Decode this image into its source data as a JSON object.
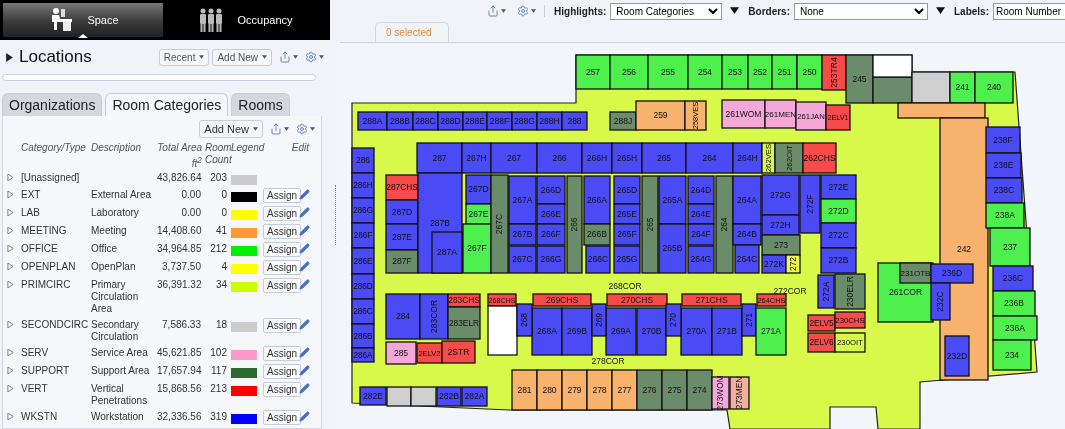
{
  "app_tabs": [
    {
      "label": "Space",
      "selected": true
    },
    {
      "label": "Occupancy",
      "selected": false
    }
  ],
  "locations": {
    "title": "Locations",
    "buttons": [
      "Recent",
      "Add New"
    ]
  },
  "tabs": [
    {
      "label": "Organizations",
      "selected": false
    },
    {
      "label": "Room Categories",
      "selected": true
    },
    {
      "label": "Rooms",
      "selected": false
    }
  ],
  "categories": {
    "add_button": "Add New",
    "columns": [
      "Category/Type",
      "Description",
      "Total Area ft$^{2}$",
      "Room Count",
      "Legend",
      "Edit"
    ],
    "rows": [
      {
        "code": "[Unassigned]",
        "area": "43,826.64",
        "count": "203",
        "color": "#cccccc"
      },
      {
        "code": "EXT",
        "description": "External Area",
        "area": "0.00",
        "count": "0",
        "color": "#000000",
        "assign": "Assign"
      },
      {
        "code": "LAB",
        "description": "Laboratory",
        "area": "0.00",
        "count": "0",
        "color": "#ffff00",
        "assign": "Assign"
      },
      {
        "code": "MEETING",
        "description": "Meeting",
        "area": "14,408.60",
        "count": "41",
        "color": "#ff9933",
        "assign": "Assign"
      },
      {
        "code": "OFFICE",
        "description": "Office",
        "area": "34,964.85",
        "count": "212",
        "color": "#00ee00",
        "assign": "Assign"
      },
      {
        "code": "OPENPLAN",
        "description": "OpenPlan",
        "area": "3,737.50",
        "count": "4",
        "color": "#ffff00",
        "assign": "Assign"
      },
      {
        "code": "PRIMCIRC",
        "description": "Primary Circulation Area",
        "area": "36,391.32",
        "count": "34",
        "color": "#ccff00",
        "assign": "Assign"
      },
      {
        "code": "SECONDCIRC",
        "description": "Secondary Circulation",
        "area": "7,586.33",
        "count": "18",
        "color": "#cccccc",
        "assign": "Assign"
      },
      {
        "code": "SERV",
        "description": "Service Area",
        "area": "45,621.85",
        "count": "102",
        "color": "#ff99cc",
        "assign": "Assign"
      },
      {
        "code": "SUPPORT",
        "description": "Support Area",
        "area": "17,657.94",
        "count": "117",
        "color": "#2d6a2d",
        "assign": "Assign"
      },
      {
        "code": "VERT",
        "description": "Vertical Penetrations",
        "area": "15,868.56",
        "count": "213",
        "color": "#ff0000",
        "assign": "Assign"
      },
      {
        "code": "WKSTN",
        "description": "Workstation",
        "area": "32,336.56",
        "count": "319",
        "color": "#0000ff",
        "assign": "Assign"
      }
    ]
  },
  "toolbar": {
    "selects": [
      {
        "label": "Highlights:",
        "value": "Room Categories"
      },
      {
        "label": "Borders:",
        "value": "None"
      },
      {
        "label": "Labels:",
        "value": "Room Number"
      }
    ]
  },
  "selection_tab": "0 selected",
  "floor_plan": {
    "rooms": [
      {
        "label": "257",
        "color": "#4df04d"
      },
      {
        "label": "256",
        "color": "#4df04d"
      },
      {
        "label": "255",
        "color": "#4df04d"
      },
      {
        "label": "254",
        "color": "#4df04d"
      },
      {
        "label": "253",
        "color": "#4df04d"
      },
      {
        "label": "252",
        "color": "#4df04d"
      },
      {
        "label": "251",
        "color": "#4df04d"
      },
      {
        "label": "250",
        "color": "#4df04d"
      },
      {
        "label": "253TR4",
        "color": "#f74a4a"
      },
      {
        "label": "245",
        "color": "#6b8c6b"
      },
      {
        "color": "#6b8c6b"
      },
      {
        "color": "#ffffff"
      },
      {
        "color": "#cfcfcf"
      },
      {
        "label": "241",
        "color": "#4df04d"
      },
      {
        "label": "240",
        "color": "#4df04d"
      },
      {
        "label": "288A",
        "color": "#4b4bf5"
      },
      {
        "label": "288B",
        "color": "#4b4bf5"
      },
      {
        "label": "288C",
        "color": "#4b4bf5"
      },
      {
        "label": "288D",
        "color": "#4b4bf5"
      },
      {
        "label": "288E",
        "color": "#4b4bf5"
      },
      {
        "label": "288F",
        "color": "#4b4bf5"
      },
      {
        "label": "288G",
        "color": "#4b4bf5"
      },
      {
        "label": "288H",
        "color": "#4b4bf5"
      },
      {
        "label": "288",
        "color": "#4b4bf5"
      },
      {
        "label": "288J",
        "color": "#6b8c6b"
      },
      {
        "label": "259",
        "color": "#f7b26e"
      },
      {
        "label": "258VES",
        "color": "#f7b26e"
      },
      {
        "label": "261WOM",
        "color": "#f5a8d8"
      },
      {
        "label": "261MEN",
        "color": "#f5a8d8"
      },
      {
        "label": "261JAN",
        "color": "#f5a8d8"
      },
      {
        "label": "2ELV1",
        "color": "#f74a4a"
      },
      {
        "label": "286",
        "color": "#4b4bf5"
      },
      {
        "label": "286H",
        "color": "#4b4bf5"
      },
      {
        "label": "286G",
        "color": "#4b4bf5"
      },
      {
        "label": "286F",
        "color": "#4b4bf5"
      },
      {
        "label": "286E",
        "color": "#4b4bf5"
      },
      {
        "label": "286D",
        "color": "#4b4bf5"
      },
      {
        "label": "286C",
        "color": "#4b4bf5"
      },
      {
        "label": "286B",
        "color": "#4b4bf5"
      },
      {
        "label": "286A",
        "color": "#4b4bf5"
      },
      {
        "label": "287",
        "color": "#4b4bf5"
      },
      {
        "label": "267H",
        "color": "#4b4bf5"
      },
      {
        "label": "267",
        "color": "#4b4bf5"
      },
      {
        "label": "266",
        "color": "#4b4bf5"
      },
      {
        "label": "266H",
        "color": "#4b4bf5"
      },
      {
        "label": "265H",
        "color": "#4b4bf5"
      },
      {
        "label": "265",
        "color": "#4b4bf5"
      },
      {
        "label": "264",
        "color": "#4b4bf5"
      },
      {
        "label": "264H",
        "color": "#4b4bf5"
      },
      {
        "label": "262VES",
        "color": "#d9f94a"
      },
      {
        "label": "262OIT",
        "color": "#6b8c6b"
      },
      {
        "label": "262CHS",
        "color": "#f74a4a"
      },
      {
        "label": "287CHS",
        "color": "#f74a4a"
      },
      {
        "label": "287D",
        "color": "#4b4bf5"
      },
      {
        "label": "287E",
        "color": "#4b4bf5"
      },
      {
        "label": "287F",
        "color": "#6b8c6b"
      },
      {
        "label": "287B",
        "color": "#4b4bf5"
      },
      {
        "label": "287A",
        "color": "#4b4bf5"
      },
      {
        "label": "267D",
        "color": "#4b4bf5"
      },
      {
        "label": "267E",
        "color": "#4df04d"
      },
      {
        "label": "267F",
        "color": "#4df04d"
      },
      {
        "label": "267C",
        "color": "#6b8c6b"
      },
      {
        "label": "267A",
        "color": "#4b4bf5"
      },
      {
        "label": "267B",
        "color": "#4b4bf5"
      },
      {
        "label": "267C",
        "color": "#4b4bf5"
      },
      {
        "label": "266D",
        "color": "#4b4bf5"
      },
      {
        "label": "266E",
        "color": "#4b4bf5"
      },
      {
        "label": "266F",
        "color": "#4b4bf5"
      },
      {
        "label": "266G",
        "color": "#4b4bf5"
      },
      {
        "label": "266",
        "color": "#6b8c6b"
      },
      {
        "label": "266A",
        "color": "#4b4bf5"
      },
      {
        "label": "266B",
        "color": "#6b8c6b"
      },
      {
        "label": "266C",
        "color": "#4b4bf5"
      },
      {
        "label": "265D",
        "color": "#4b4bf5"
      },
      {
        "label": "265E",
        "color": "#4b4bf5"
      },
      {
        "label": "265F",
        "color": "#4b4bf5"
      },
      {
        "label": "265G",
        "color": "#4b4bf5"
      },
      {
        "label": "265",
        "color": "#6b8c6b"
      },
      {
        "label": "265A",
        "color": "#4b4bf5"
      },
      {
        "label": "265B",
        "color": "#4b4bf5"
      },
      {
        "label": "264D",
        "color": "#4b4bf5"
      },
      {
        "label": "264E",
        "color": "#4b4bf5"
      },
      {
        "label": "264F",
        "color": "#4b4bf5"
      },
      {
        "label": "264G",
        "color": "#4b4bf5"
      },
      {
        "label": "264",
        "color": "#6b8c6b"
      },
      {
        "label": "264A",
        "color": "#4b4bf5"
      },
      {
        "label": "264B",
        "color": "#4b4bf5"
      },
      {
        "label": "264C",
        "color": "#4b4bf5"
      },
      {
        "label": "272G",
        "color": "#4b4bf5"
      },
      {
        "label": "272H",
        "color": "#4b4bf5"
      },
      {
        "label": "273",
        "color": "#6b8c6b"
      },
      {
        "label": "272K",
        "color": "#4b4bf5"
      },
      {
        "label": "272",
        "color": "#eef94a"
      },
      {
        "label": "272F",
        "color": "#4b4bf5"
      },
      {
        "label": "272E",
        "color": "#4b4bf5"
      },
      {
        "label": "272D",
        "color": "#4df04d"
      },
      {
        "label": "272C",
        "color": "#4b4bf5"
      },
      {
        "label": "272B",
        "color": "#4b4bf5"
      },
      {
        "color": "#f7b26e"
      },
      {
        "label": "242",
        "color": "#f7b26e"
      },
      {
        "label": "238F",
        "color": "#4b4bf5"
      },
      {
        "label": "238E",
        "color": "#4b4bf5"
      },
      {
        "label": "238C",
        "color": "#4b4bf5"
      },
      {
        "label": "238A",
        "color": "#4df04d"
      },
      {
        "label": "237",
        "color": "#4df04d"
      },
      {
        "label": "236C",
        "color": "#4b4bf5"
      },
      {
        "label": "236B",
        "color": "#4df04d"
      },
      {
        "label": "236A",
        "color": "#4df04d"
      },
      {
        "label": "234",
        "color": "#4df04d"
      },
      {
        "label": "261COR",
        "color": "#4df04d"
      },
      {
        "label": "231OTB",
        "color": "#6b8c6b"
      },
      {
        "label": "236D",
        "color": "#4b4bf5"
      },
      {
        "label": "232C",
        "color": "#4b4bf5"
      },
      {
        "label": "232D",
        "color": "#4b4bf5"
      },
      {
        "label": "268CHS",
        "color": "#f74a4a"
      },
      {
        "label": "269CHS",
        "color": "#f74a4a"
      },
      {
        "label": "270CHS",
        "color": "#f74a4a"
      },
      {
        "label": "271CHS",
        "color": "#f74a4a"
      },
      {
        "label": "264CHS",
        "color": "#f74a4a"
      },
      {
        "color": "#ffffff"
      },
      {
        "label": "268A",
        "color": "#4b4bf5"
      },
      {
        "label": "268",
        "color": "#4b4bf5"
      },
      {
        "label": "269B",
        "color": "#4b4bf5"
      },
      {
        "label": "269A",
        "color": "#4b4bf5"
      },
      {
        "label": "269",
        "color": "#4b4bf5"
      },
      {
        "label": "270B",
        "color": "#4b4bf5"
      },
      {
        "label": "270A",
        "color": "#4b4bf5"
      },
      {
        "label": "270",
        "color": "#4b4bf5"
      },
      {
        "label": "271B",
        "color": "#4b4bf5"
      },
      {
        "label": "271",
        "color": "#4b4bf5"
      },
      {
        "label": "271A",
        "color": "#4df04d"
      },
      {
        "label": "284",
        "color": "#4b4bf5"
      },
      {
        "label": "283COR",
        "color": "#4b4bf5"
      },
      {
        "label": "283CHS",
        "color": "#f74a4a"
      },
      {
        "label": "283ELR",
        "color": "#6b8c6b"
      },
      {
        "label": "285",
        "color": "#f5a8d8"
      },
      {
        "label": "2ELV2",
        "color": "#f74a4a"
      },
      {
        "label": "2STR",
        "color": "#f74a4a"
      },
      {
        "label": "281",
        "color": "#f7b26e"
      },
      {
        "label": "280",
        "color": "#f7b26e"
      },
      {
        "label": "279",
        "color": "#f7b26e"
      },
      {
        "label": "278",
        "color": "#f7b26e"
      },
      {
        "label": "277",
        "color": "#f7b26e"
      },
      {
        "label": "276",
        "color": "#6b8c6b"
      },
      {
        "label": "275",
        "color": "#6b8c6b"
      },
      {
        "label": "274",
        "color": "#6b8c6b"
      },
      {
        "label": "273WOM",
        "color": "#f5a8d8"
      },
      {
        "label": "273MEN",
        "color": "#f0b0a0"
      },
      {
        "label": "282E",
        "color": "#4b4bf5"
      },
      {
        "color": "#cfcfcf"
      },
      {
        "color": "#cfcfcf"
      },
      {
        "label": "282B",
        "color": "#4b4bf5"
      },
      {
        "label": "282A",
        "color": "#4b4bf5"
      },
      {
        "label": "272A",
        "color": "#4b4bf5"
      },
      {
        "label": "230ELR",
        "color": "#6b8c6b"
      },
      {
        "label": "2ELV5",
        "color": "#f74a4a"
      },
      {
        "label": "230CHS",
        "color": "#f74a4a"
      },
      {
        "label": "2ELV6",
        "color": "#f74a4a"
      },
      {
        "label": "230OIT",
        "color": "#d9f94a"
      }
    ],
    "corridor_labels": [
      "268COR",
      "278COR",
      "272COR"
    ]
  }
}
